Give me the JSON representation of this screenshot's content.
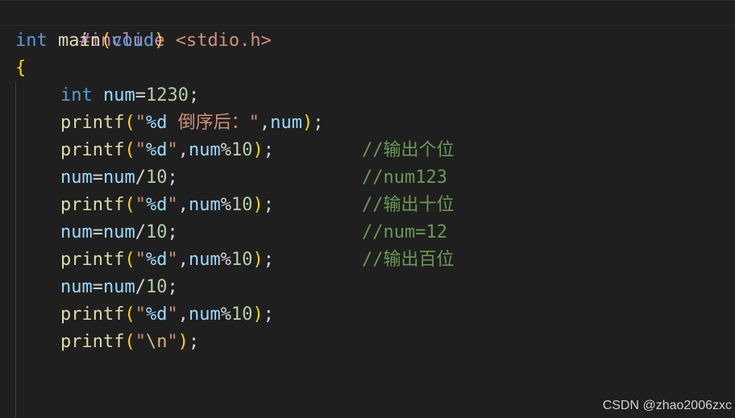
{
  "editor": {
    "line1": {
      "directive": "#include",
      "header": "<stdio.h>"
    },
    "line2": {
      "type": "int",
      "name": "main",
      "lparen": "(",
      "param": "void",
      "rparen": ")"
    },
    "line3": {
      "brace": "{"
    },
    "line4": {
      "type": "int",
      "var": "num",
      "eq": "=",
      "value": "1230",
      "semi": ";"
    },
    "line5": {
      "fn": "printf",
      "lparen": "(",
      "q1": "\"",
      "fmt": "%d",
      "text": " 倒序后：",
      "q2": "\"",
      "comma": ",",
      "arg": "num",
      "rparen": ")",
      "semi": ";"
    },
    "line6": {
      "fn": "printf",
      "lparen": "(",
      "q1": "\"",
      "fmt": "%d",
      "q2": "\"",
      "comma": ",",
      "arg": "num",
      "mod": "%",
      "n": "10",
      "rparen": ")",
      "semi": ";",
      "comment": "//输出个位"
    },
    "line7": {
      "a": "num",
      "eq": "=",
      "b": "num",
      "div": "/",
      "n": "10",
      "semi": ";",
      "comment": "//num123"
    },
    "line8": {
      "fn": "printf",
      "lparen": "(",
      "q1": "\"",
      "fmt": "%d",
      "q2": "\"",
      "comma": ",",
      "arg": "num",
      "mod": "%",
      "n": "10",
      "rparen": ")",
      "semi": ";",
      "comment": "//输出十位"
    },
    "line9": {
      "a": "num",
      "eq": "=",
      "b": "num",
      "div": "/",
      "n": "10",
      "semi": ";",
      "comment": "//num=12"
    },
    "line10": {
      "fn": "printf",
      "lparen": "(",
      "q1": "\"",
      "fmt": "%d",
      "q2": "\"",
      "comma": ",",
      "arg": "num",
      "mod": "%",
      "n": "10",
      "rparen": ")",
      "semi": ";",
      "comment": "//输出百位"
    },
    "line11": {
      "a": "num",
      "eq": "=",
      "b": "num",
      "div": "/",
      "n": "10",
      "semi": ";"
    },
    "line12": {
      "fn": "printf",
      "lparen": "(",
      "q1": "\"",
      "fmt": "%d",
      "q2": "\"",
      "comma": ",",
      "arg": "num",
      "mod": "%",
      "n": "10",
      "rparen": ")",
      "semi": ";"
    },
    "line13": {
      "fn": "printf",
      "lparen": "(",
      "q1": "\"",
      "esc": "\\n",
      "q2": "\"",
      "rparen": ")",
      "semi": ";"
    }
  },
  "watermark": "CSDN @zhao2006zxc",
  "colors": {
    "background": "#1f1f1f",
    "keyword": "#569cd6",
    "function": "#dcdcaa",
    "variable": "#9cdcfe",
    "number": "#b5cea8",
    "string": "#ce9178",
    "comment": "#6a9955",
    "preprocessor": "#c586c0",
    "bracket_level1": "#ffd700",
    "bracket_level2": "#da70d6"
  }
}
